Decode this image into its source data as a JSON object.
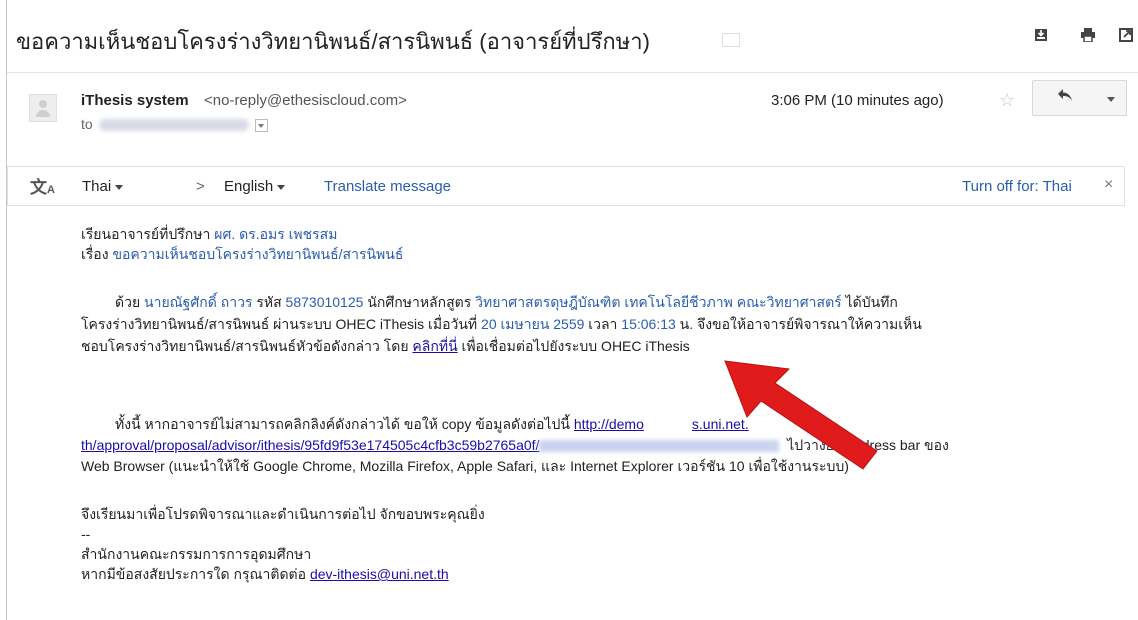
{
  "subject": "ขอความเห็นชอบโครงร่างวิทยานิพนธ์/สารนิพนธ์ (อาจารย์ที่ปรึกษา)",
  "toolbar": {
    "icons": [
      "download-icon",
      "print-icon",
      "new-window-icon"
    ]
  },
  "sender": {
    "name": "iThesis system",
    "email": "<no-reply@ethesiscloud.com>",
    "to_label": "to",
    "time": "3:06 PM (10 minutes ago)",
    "reply_icon": "reply-icon"
  },
  "translate": {
    "from_lang": "Thai",
    "arrow": ">",
    "to_lang": "English",
    "action": "Translate message",
    "turn_off": "Turn off for: Thai",
    "close": "×"
  },
  "message": {
    "line1_prefix": "เรียนอาจารย์ที่ปรึกษา",
    "line1_name": "ผศ. ดร.อมร เพชรสม",
    "line2_prefix": "เรื่อง",
    "line2_subject": "ขอความเห็นชอบโครงร่างวิทยานิพนธ์/สารนิพนธ์",
    "p1_a": "ด้วย",
    "p1_student": "นายณัฐศักดิ์ ถาวร",
    "p1_b": "รหัส",
    "p1_id": "5873010125",
    "p1_c": "นักศึกษาหลักสูตร",
    "p1_program": "วิทยาศาสตรดุษฎีบัณฑิต เทคโนโลยีชีวภาพ คณะวิทยาศาสตร์",
    "p1_d": "ได้บันทึก",
    "p1_line2_a": "โครงร่างวิทยานิพนธ์/สารนิพนธ์ ผ่านระบบ OHEC iThesis เมื่อวันที่",
    "p1_date": "20 เมษายน 2559",
    "p1_line2_b": "เวลา",
    "p1_time": "15:06:13",
    "p1_line2_c": "น. จึงขอให้อาจารย์พิจารณาให้ความเห็น",
    "p1_line3_a": "ชอบโครงร่างวิทยานิพนธ์/สารนิพนธ์หัวข้อดังกล่าว โดย",
    "p1_click": "คลิกที่นี่",
    "p1_line3_b": "เพื่อเชื่อมต่อไปยังระบบ OHEC iThesis",
    "p2_a": "ทั้งนี้ หากอาจารย์ไม่สามารถคลิกลิงค์ดังกล่าวได้ ขอให้ copy ข้อมูลดังต่อไปนี้",
    "p2_link1": "http://demo",
    "p2_link1_end": "s.uni.net.",
    "p2_link2": "th/approval/proposal/advisor/ithesis/95fd9f53e174505c4cfb3c59b2765a0f/",
    "p2_b": "ไปวางยัง Address bar ของ",
    "p2_line3": "Web Browser (แนะนำให้ใช้ Google Chrome, Mozilla Firefox, Apple Safari, และ Internet Explorer เวอร์ชัน 10 เพื่อใช้งานระบบ)",
    "closing": "จึงเรียนมาเพื่อโปรดพิจารณาและดำเนินการต่อไป จักขอบพระคุณยิ่ง",
    "sig_dash": "--",
    "sig_org": "สำนักงานคณะกรรมการการอุดมศึกษา",
    "sig_contact": "หากมีข้อสงสัยประการใด กรุณาติดต่อ",
    "sig_email": "dev-ithesis@uni.net.th"
  },
  "colors": {
    "link": "#1a0dab",
    "accent_text": "#2a5db0",
    "arrow": "#e01b1b"
  }
}
